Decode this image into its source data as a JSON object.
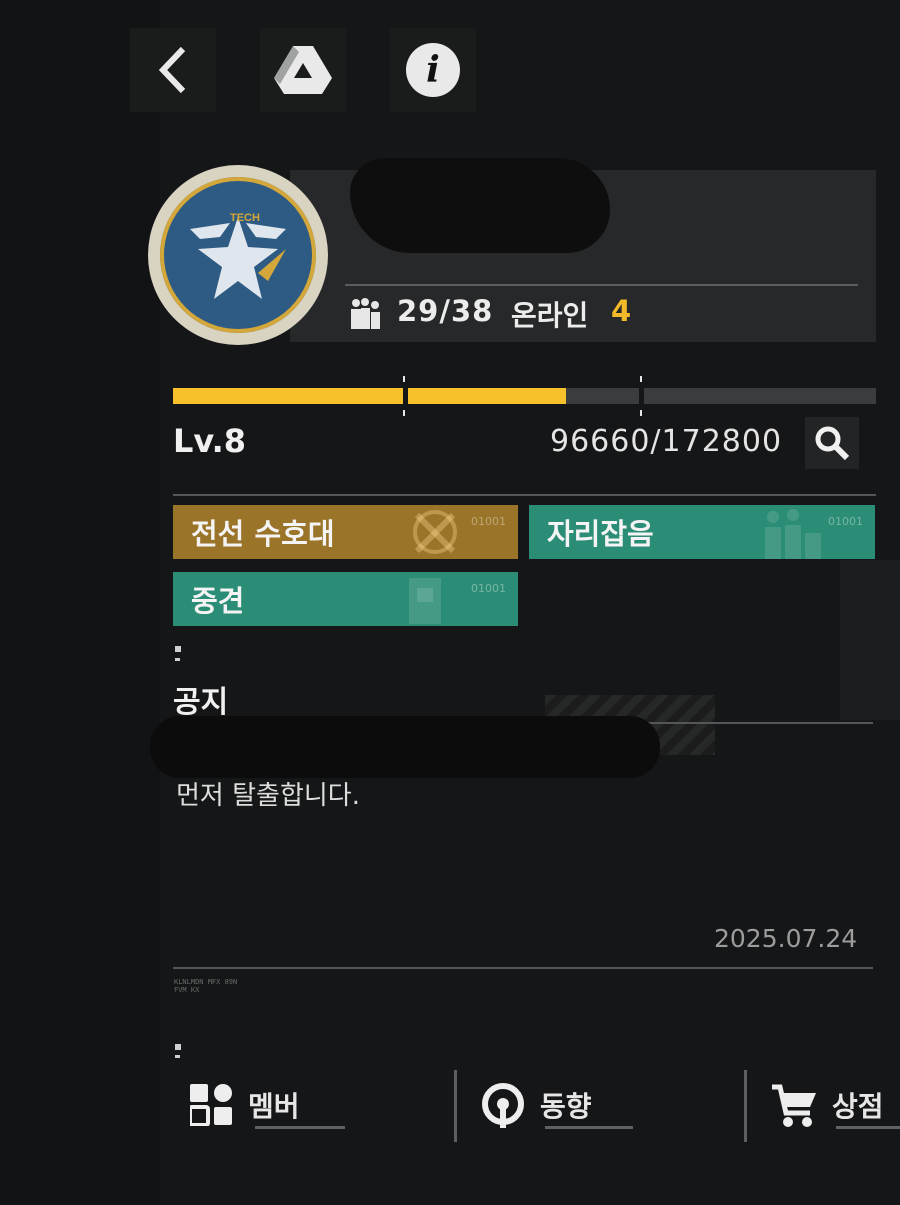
{
  "topbar": {
    "back_icon": "chevron-left-icon",
    "drive_icon": "drive-triangle-icon",
    "info_icon": "info-icon",
    "info_glyph": "i"
  },
  "clan": {
    "emblem_icon": "tech-star-emblem",
    "emblem_text": "TECH",
    "members": "29/38",
    "online_label": "온라인",
    "online_count": "4"
  },
  "level": {
    "label": "Lv.8",
    "exp_text": "96660/172800",
    "exp_current": 96660,
    "exp_max": 172800
  },
  "tags": [
    {
      "label": "전선 수호대",
      "code": "01001",
      "color": "#9a7429"
    },
    {
      "label": "자리잡음",
      "code": "01001",
      "color": "#2c8d76"
    },
    {
      "label": "중견",
      "code": "01001",
      "color": "#2c8d76"
    }
  ],
  "notice": {
    "title": "공지",
    "text": "먼저 탈출합니다.",
    "date": "2025.07.24"
  },
  "footer_small": "KLNLMDN MFX 89N\nFVM KX",
  "nav": [
    {
      "label": "멤버",
      "icon": "grid-icon"
    },
    {
      "label": "동향",
      "icon": "activity-icon"
    },
    {
      "label": "상점",
      "icon": "cart-icon"
    }
  ],
  "colors": {
    "accent_gold": "#f4b928",
    "teal": "#2c8d76",
    "gold_tag": "#9a7429"
  }
}
